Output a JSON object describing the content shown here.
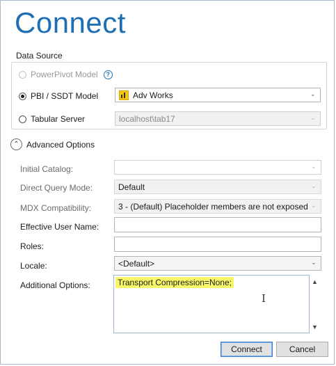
{
  "dialog": {
    "title": "Connect"
  },
  "data_source": {
    "group_label": "Data Source",
    "options": [
      {
        "label": "PowerPivot Model",
        "checked": false,
        "disabled": true,
        "help_icon": "help-circle-icon"
      },
      {
        "label": "PBI / SSDT Model",
        "checked": true,
        "disabled": false,
        "combo_value": "Adv Works",
        "combo_icon": "power-bi-icon"
      },
      {
        "label": "Tabular Server",
        "checked": false,
        "disabled": false,
        "combo_value": "localhost\\tab17",
        "combo_disabled": true
      }
    ]
  },
  "advanced": {
    "toggle_label": "Advanced Options",
    "expanded": true,
    "fields": {
      "initial_catalog": {
        "label": "Initial Catalog:",
        "value": ""
      },
      "direct_query_mode": {
        "label": "Direct Query Mode:",
        "value": "Default"
      },
      "mdx_compatibility": {
        "label": "MDX Compatibility:",
        "value": "3 - (Default) Placeholder members are not exposed"
      },
      "effective_user_name": {
        "label": "Effective User Name:",
        "value": ""
      },
      "roles": {
        "label": "Roles:",
        "value": ""
      },
      "locale": {
        "label": "Locale:",
        "value": "<Default>"
      },
      "additional_options": {
        "label": "Additional Options:",
        "value": "Transport Compression=None;"
      }
    }
  },
  "buttons": {
    "connect": "Connect",
    "cancel": "Cancel"
  },
  "colors": {
    "title": "#1e6eb4",
    "highlight": "#f8f76a",
    "default_button_border": "#3c7fd1"
  }
}
